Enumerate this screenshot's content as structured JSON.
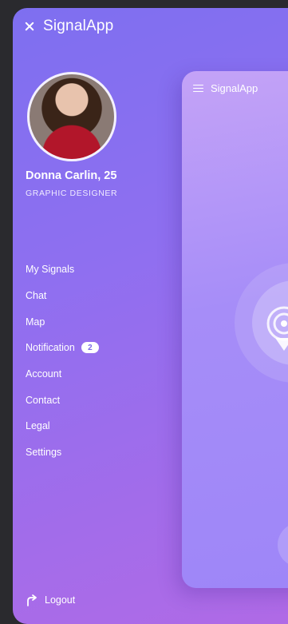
{
  "header": {
    "title": "SignalApp",
    "close_icon": "close-icon"
  },
  "profile": {
    "name": "Donna Carlin, 25",
    "role": "GRAPHIC DESIGNER"
  },
  "menu": {
    "items": [
      {
        "label": "My Signals"
      },
      {
        "label": "Chat"
      },
      {
        "label": "Map"
      },
      {
        "label": "Notification",
        "badge": "2"
      },
      {
        "label": "Account"
      },
      {
        "label": "Contact"
      },
      {
        "label": "Legal"
      },
      {
        "label": "Settings"
      }
    ]
  },
  "logout": {
    "label": "Logout",
    "icon": "logout-icon"
  },
  "preview": {
    "title": "SignalApp",
    "menu_icon": "hamburger-icon",
    "center_icon": "signal-icon"
  },
  "colors": {
    "gradient_start": "#7e6ff0",
    "gradient_end": "#b06ae6",
    "badge_text": "#7b6ae8"
  }
}
